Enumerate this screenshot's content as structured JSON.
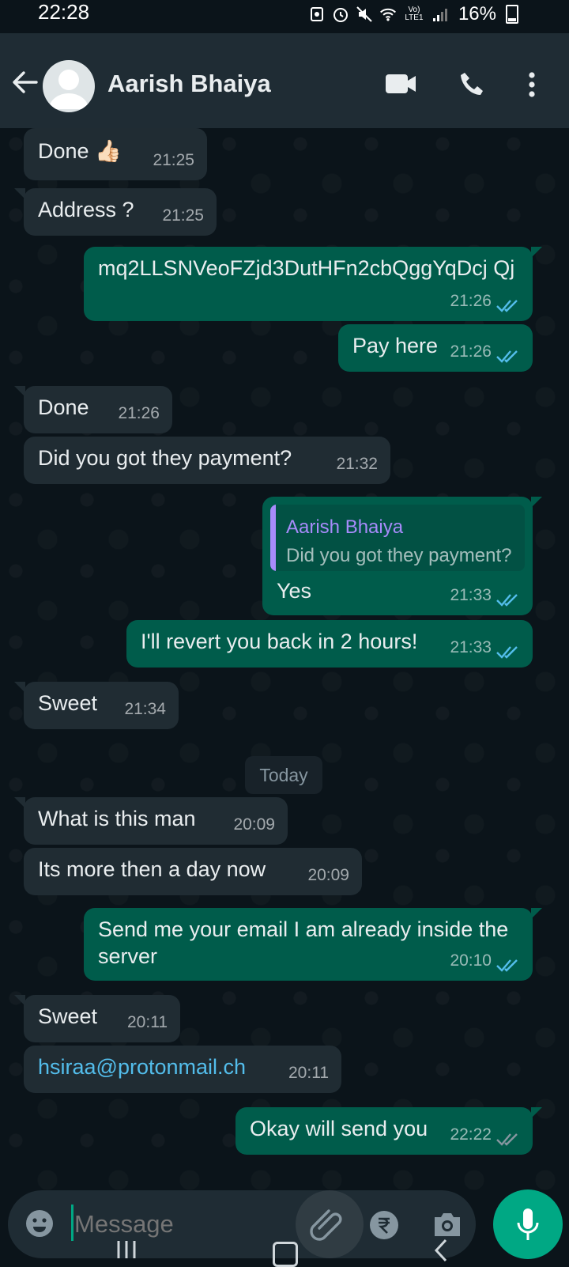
{
  "status_bar": {
    "time": "22:28",
    "lte_label": "Vo) LTE1",
    "battery": "16%"
  },
  "header": {
    "contact_name": "Aarish Bhaiya"
  },
  "messages": [
    {
      "direction": "in",
      "text": "Done 👍🏻",
      "time": "21:25"
    },
    {
      "direction": "in",
      "text": "Address ?",
      "time": "21:25"
    },
    {
      "direction": "out",
      "text": "mq2LLSNVeoFZjd3DutHFn2cbQggYqDcj Qj",
      "time": "21:26",
      "status": "read"
    },
    {
      "direction": "out",
      "text": "Pay here",
      "time": "21:26",
      "status": "read"
    },
    {
      "direction": "in",
      "text": "Done",
      "time": "21:26"
    },
    {
      "direction": "in",
      "text": "Did you got they payment?",
      "time": "21:32"
    },
    {
      "direction": "out",
      "text": "Yes",
      "time": "21:33",
      "status": "read",
      "quote": {
        "name": "Aarish Bhaiya",
        "text": "Did you got they payment?"
      }
    },
    {
      "direction": "out",
      "text": "I'll revert you back in 2 hours!",
      "time": "21:33",
      "status": "read"
    },
    {
      "direction": "in",
      "text": "Sweet",
      "time": "21:34"
    },
    {
      "direction": "in",
      "text": "What is this man",
      "time": "20:09"
    },
    {
      "direction": "in",
      "text": "Its more then a day now",
      "time": "20:09"
    },
    {
      "direction": "out",
      "text": "Send me your email I am already inside the server",
      "time": "20:10",
      "status": "read"
    },
    {
      "direction": "in",
      "text": "Sweet",
      "time": "20:11"
    },
    {
      "direction": "in",
      "text": "hsiraa@protonmail.ch",
      "time": "20:11"
    },
    {
      "direction": "out",
      "text": "Okay will send you",
      "time": "22:22",
      "status": "delivered"
    }
  ],
  "date_divider": "Today",
  "composer": {
    "placeholder": "Message"
  },
  "colors": {
    "read_tick": "#53bdeb",
    "delivered_tick": "#8696a0",
    "accent": "#00a884",
    "quote_name": "#a78bfa"
  }
}
